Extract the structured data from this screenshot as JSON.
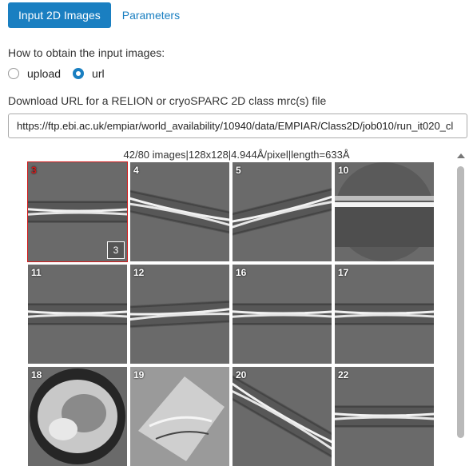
{
  "tabs": {
    "active": "Input 2D Images",
    "inactive": "Parameters"
  },
  "source": {
    "question": "How to obtain the input images:",
    "options": [
      {
        "label": "upload",
        "checked": false
      },
      {
        "label": "url",
        "checked": true
      }
    ]
  },
  "download": {
    "label": "Download URL for a RELION or cryoSPARC 2D class mrc(s) file",
    "value": "https://ftp.ebi.ac.uk/empiar/world_availability/10940/data/EMPIAR/Class2D/job010/run_it020_cl"
  },
  "images_info": "42/80 images|128x128|4.944Å/pixel|length=633Å",
  "tiles": [
    {
      "label": "3",
      "badge": "3",
      "selected": true,
      "kind": "band",
      "tilt": 0
    },
    {
      "label": "4",
      "kind": "band",
      "tilt": 12
    },
    {
      "label": "5",
      "kind": "band",
      "tilt": -14
    },
    {
      "label": "10",
      "kind": "bright",
      "tilt": 0
    },
    {
      "label": "11",
      "kind": "band",
      "tilt": 0
    },
    {
      "label": "12",
      "kind": "band",
      "tilt": -3
    },
    {
      "label": "16",
      "kind": "band",
      "tilt": 0
    },
    {
      "label": "17",
      "kind": "band",
      "tilt": 0
    },
    {
      "label": "18",
      "kind": "blob",
      "tilt": 0
    },
    {
      "label": "19",
      "kind": "diamond",
      "tilt": 0
    },
    {
      "label": "20",
      "kind": "band",
      "tilt": 30
    },
    {
      "label": "22",
      "kind": "band",
      "tilt": 0
    }
  ],
  "colors": {
    "accent": "#1a7fc1",
    "selection": "#d21b1b"
  }
}
